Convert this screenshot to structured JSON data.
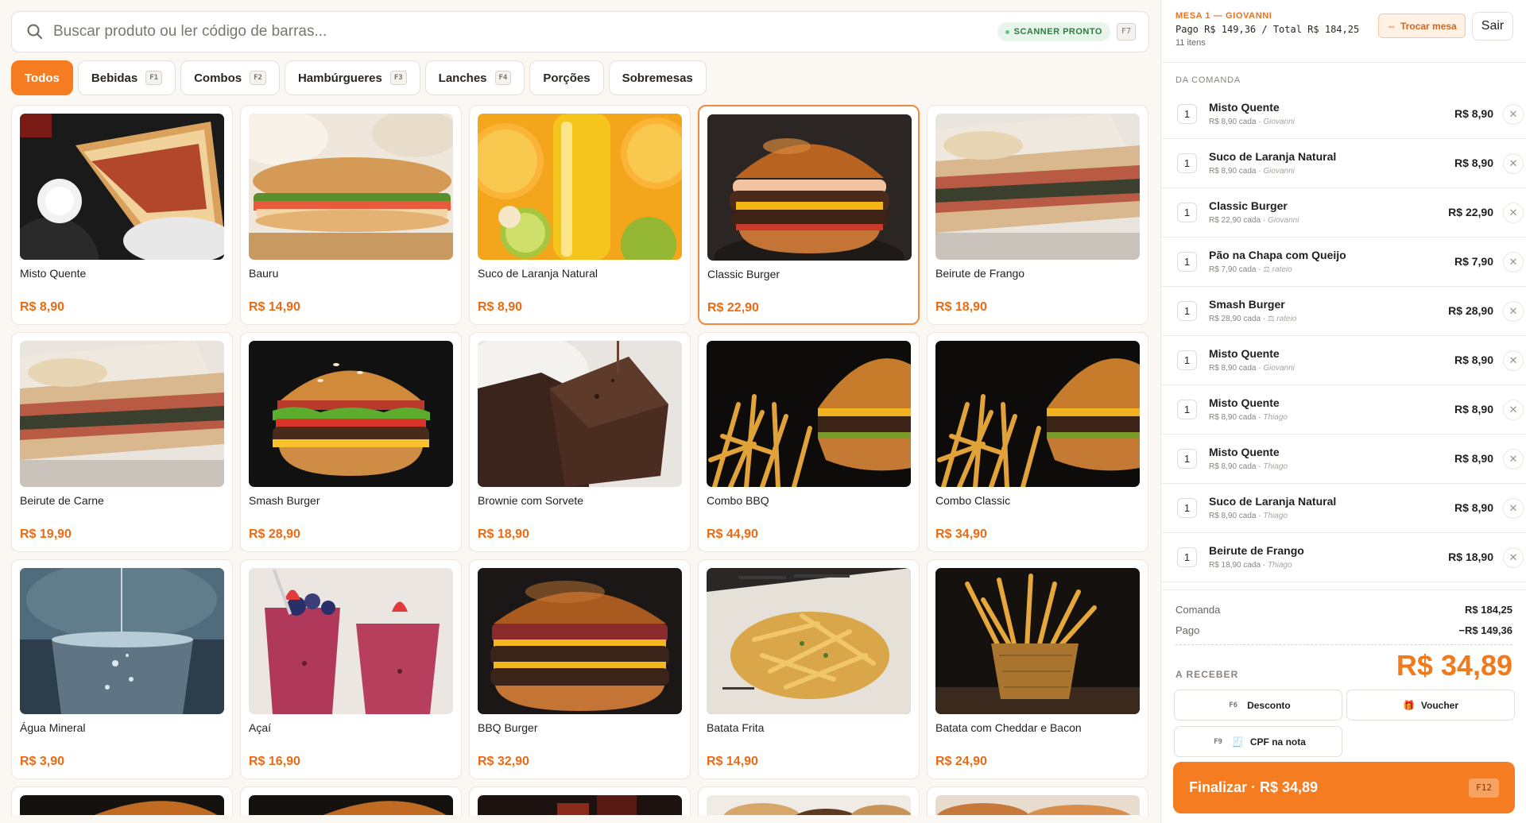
{
  "search": {
    "placeholder": "Buscar produto ou ler código de barras...",
    "scanner_status": "SCANNER PRONTO",
    "shortcut": "F7"
  },
  "categories": [
    {
      "label": "Todos",
      "key": "",
      "active": true
    },
    {
      "label": "Bebidas",
      "key": "F1"
    },
    {
      "label": "Combos",
      "key": "F2"
    },
    {
      "label": "Hambúrgueres",
      "key": "F3"
    },
    {
      "label": "Lanches",
      "key": "F4"
    },
    {
      "label": "Porções",
      "key": ""
    },
    {
      "label": "Sobremesas",
      "key": ""
    }
  ],
  "products": [
    {
      "name": "Misto Quente",
      "price": "R$ 8,90",
      "image": "toasted-sandwich"
    },
    {
      "name": "Bauru",
      "price": "R$ 14,90",
      "image": "baguette-sandwich"
    },
    {
      "name": "Suco de Laranja Natural",
      "price": "R$ 8,90",
      "image": "orange-juice"
    },
    {
      "name": "Classic Burger",
      "price": "R$ 22,90",
      "image": "burger",
      "selected": true
    },
    {
      "name": "Beirute de Frango",
      "price": "R$ 18,90",
      "image": "toasted-sandwich-light"
    },
    {
      "name": "Beirute de Carne",
      "price": "R$ 19,90",
      "image": "toasted-sandwich-light"
    },
    {
      "name": "Smash Burger",
      "price": "R$ 28,90",
      "image": "burger-lettuce"
    },
    {
      "name": "Brownie com Sorvete",
      "price": "R$ 18,90",
      "image": "brownie"
    },
    {
      "name": "Combo BBQ",
      "price": "R$ 44,90",
      "image": "burger-fries"
    },
    {
      "name": "Combo Classic",
      "price": "R$ 34,90",
      "image": "burger-fries"
    },
    {
      "name": "Água Mineral",
      "price": "R$ 3,90",
      "image": "water-glass"
    },
    {
      "name": "Açaí",
      "price": "R$ 16,90",
      "image": "acai-cups"
    },
    {
      "name": "BBQ Burger",
      "price": "R$ 32,90",
      "image": "bbq-burger"
    },
    {
      "name": "Batata Frita",
      "price": "R$ 14,90",
      "image": "fries-basket"
    },
    {
      "name": "Batata com Cheddar e Bacon",
      "price": "R$ 24,90",
      "image": "fries-cup"
    }
  ],
  "partial_images": [
    "burger-top",
    "burger-top",
    "drinks",
    "bread-rolls",
    "pastry"
  ],
  "colors": {
    "accent": "#f57c20",
    "price": "#ec6a12",
    "scanner": "#2f7a44"
  },
  "table": {
    "title": "MESA 1 — GIOVANNI",
    "paid_line": "Pago R$ 149,36 / Total R$ 184,25",
    "items_count": "11 itens",
    "swap_label": "Trocar mesa",
    "exit_label": "Sair",
    "section_label": "DA COMANDA"
  },
  "order": [
    {
      "qty": "1",
      "name": "Misto Quente",
      "unit": "R$ 8,90 cada",
      "who": "Giovanni",
      "total": "R$ 8,90"
    },
    {
      "qty": "1",
      "name": "Suco de Laranja Natural",
      "unit": "R$ 8,90 cada",
      "who": "Giovanni",
      "total": "R$ 8,90"
    },
    {
      "qty": "1",
      "name": "Classic Burger",
      "unit": "R$ 22,90 cada",
      "who": "Giovanni",
      "total": "R$ 22,90"
    },
    {
      "qty": "1",
      "name": "Pão na Chapa com Queijo",
      "unit": "R$ 7,90 cada",
      "who": "⚖ rateio",
      "total": "R$ 7,90"
    },
    {
      "qty": "1",
      "name": "Smash Burger",
      "unit": "R$ 28,90 cada",
      "who": "⚖ rateio",
      "total": "R$ 28,90"
    },
    {
      "qty": "1",
      "name": "Misto Quente",
      "unit": "R$ 8,90 cada",
      "who": "Giovanni",
      "total": "R$ 8,90"
    },
    {
      "qty": "1",
      "name": "Misto Quente",
      "unit": "R$ 8,90 cada",
      "who": "Thiago",
      "total": "R$ 8,90"
    },
    {
      "qty": "1",
      "name": "Misto Quente",
      "unit": "R$ 8,90 cada",
      "who": "Thiago",
      "total": "R$ 8,90"
    },
    {
      "qty": "1",
      "name": "Suco de Laranja Natural",
      "unit": "R$ 8,90 cada",
      "who": "Thiago",
      "total": "R$ 8,90"
    },
    {
      "qty": "1",
      "name": "Beirute de Frango",
      "unit": "R$ 18,90 cada",
      "who": "Thiago",
      "total": "R$ 18,90"
    }
  ],
  "summary": {
    "comanda_label": "Comanda",
    "comanda_value": "R$ 184,25",
    "paid_label": "Pago",
    "paid_value": "−R$ 149,36",
    "receive_label": "A RECEBER",
    "receive_value": "R$ 34,89"
  },
  "actions": {
    "discount_key": "F6",
    "discount_label": "Desconto",
    "voucher_label": "Voucher",
    "cpf_key": "F9",
    "cpf_label": "CPF na nota"
  },
  "finish": {
    "label": "Finalizar · R$ 34,89",
    "key": "F12"
  }
}
